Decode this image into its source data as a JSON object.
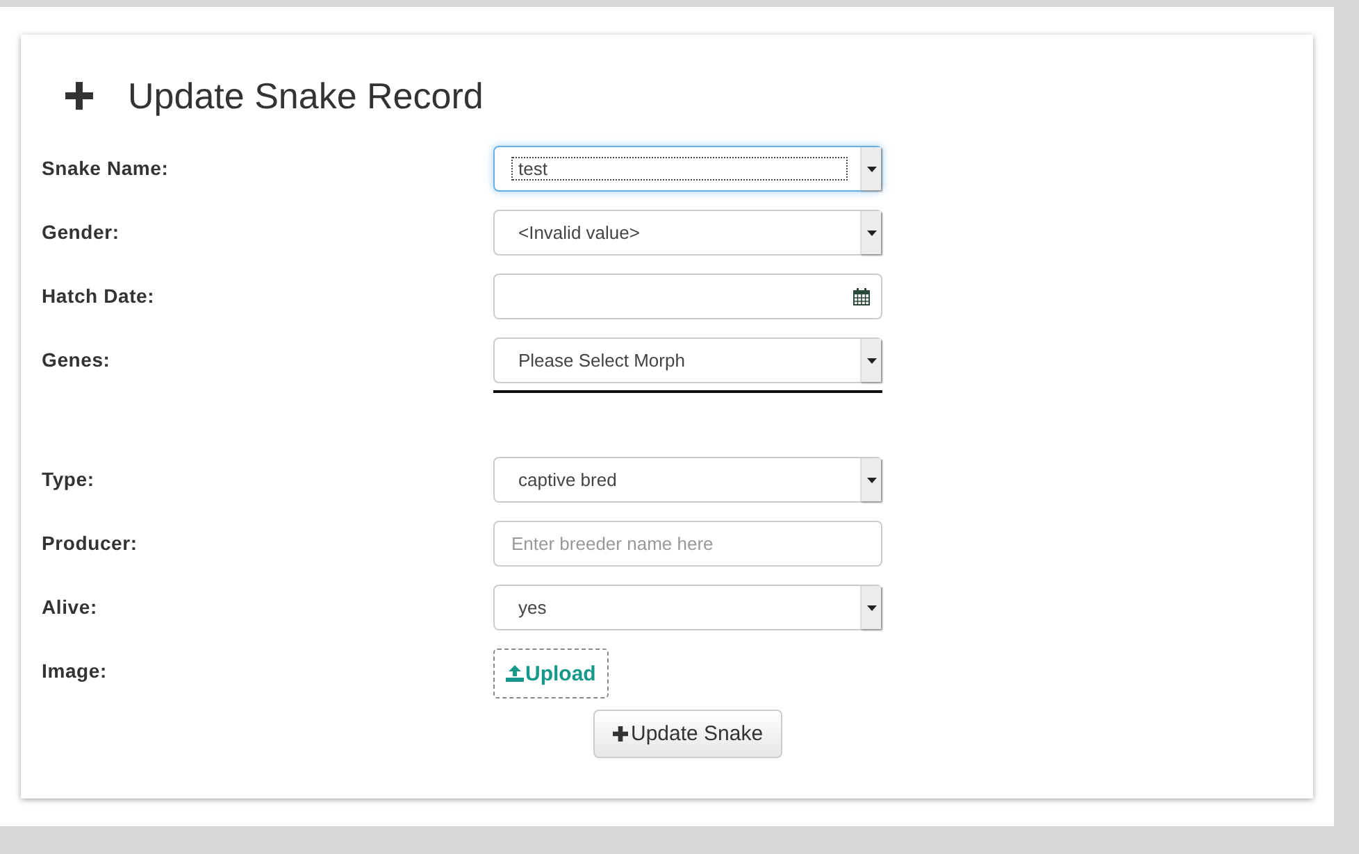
{
  "form": {
    "title": "Update Snake Record",
    "fields": [
      {
        "label": "Snake Name:",
        "kind": "select",
        "value": "test",
        "focused": true
      },
      {
        "label": "Gender:",
        "kind": "select",
        "value": "<Invalid value>",
        "focused": false
      },
      {
        "label": "Hatch Date:",
        "kind": "date",
        "focused": false
      },
      {
        "label": "Genes:",
        "kind": "select",
        "value": "Please Select Morph",
        "focused": false,
        "underline": true
      },
      {
        "label": "Type:",
        "kind": "select",
        "value": "captive bred",
        "focused": false
      },
      {
        "label": "Producer:",
        "kind": "text",
        "placeholder": "Enter breeder name here",
        "focused": false
      },
      {
        "label": "Alive:",
        "kind": "select",
        "value": "yes",
        "focused": false
      },
      {
        "label": "Image:",
        "kind": "upload",
        "button": "Upload",
        "focused": false
      }
    ],
    "submit": "Update Snake"
  }
}
